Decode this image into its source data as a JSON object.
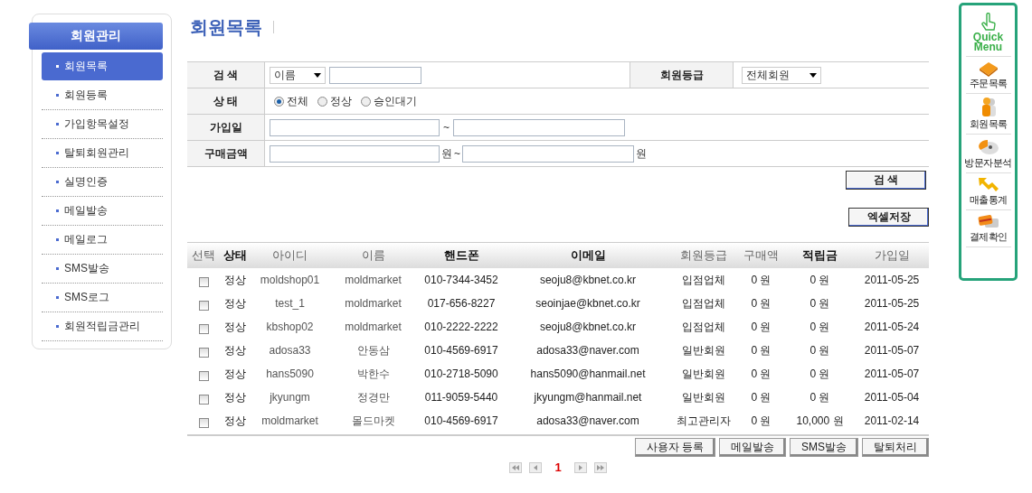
{
  "sidebar": {
    "title": "회원관리",
    "items": [
      {
        "label": "회원목록",
        "selected": true
      },
      {
        "label": "회원등록",
        "selected": false
      },
      {
        "label": "가입항목설정",
        "selected": false
      },
      {
        "label": "탈퇴회원관리",
        "selected": false
      },
      {
        "label": "실명인증",
        "selected": false
      },
      {
        "label": "메일발송",
        "selected": false
      },
      {
        "label": "메일로그",
        "selected": false
      },
      {
        "label": "SMS발송",
        "selected": false
      },
      {
        "label": "SMS로그",
        "selected": false
      },
      {
        "label": "회원적립금관리",
        "selected": false
      }
    ]
  },
  "page_title": "회원목록",
  "search_form": {
    "search_label": "검 색",
    "search_type": "이름",
    "grade_label": "회원등급",
    "grade_select": "전체회원",
    "status_label": "상 태",
    "status_options": [
      {
        "label": "전체",
        "selected": true
      },
      {
        "label": "정상",
        "selected": false
      },
      {
        "label": "승인대기",
        "selected": false
      }
    ],
    "join_label": "가입일",
    "join_separator": "~",
    "amount_label": "구매금액",
    "amount_unit": "원",
    "amount_separator": "~",
    "amount_unit_end": "원"
  },
  "search_button": "검 색",
  "excel_button": "엑셀저장",
  "table": {
    "columns": [
      {
        "label": "선택",
        "bold": false
      },
      {
        "label": "상태",
        "bold": true
      },
      {
        "label": "아이디",
        "bold": false
      },
      {
        "label": "이름",
        "bold": false
      },
      {
        "label": "핸드폰",
        "bold": true
      },
      {
        "label": "이메일",
        "bold": true
      },
      {
        "label": "회원등급",
        "bold": false
      },
      {
        "label": "구매액",
        "bold": false
      },
      {
        "label": "적립금",
        "bold": true
      },
      {
        "label": "가입일",
        "bold": false
      }
    ],
    "rows": [
      {
        "checked": false,
        "cells": [
          "",
          "정상",
          "moldshop01",
          "moldmarket",
          "010-7344-3452",
          "seoju8@kbnet.co.kr",
          "입점업체",
          "0 원",
          "0 원",
          "2011-05-25"
        ]
      },
      {
        "checked": false,
        "cells": [
          "",
          "정상",
          "test_1",
          "moldmarket",
          "017-656-8227",
          "seoinjae@kbnet.co.kr",
          "입점업체",
          "0 원",
          "0 원",
          "2011-05-25"
        ]
      },
      {
        "checked": false,
        "cells": [
          "",
          "정상",
          "kbshop02",
          "moldmarket",
          "010-2222-2222",
          "seoju8@kbnet.co.kr",
          "입점업체",
          "0 원",
          "0 원",
          "2011-05-24"
        ]
      },
      {
        "checked": false,
        "cells": [
          "",
          "정상",
          "adosa33",
          "안동삼",
          "010-4569-6917",
          "adosa33@naver.com",
          "일반회원",
          "0 원",
          "0 원",
          "2011-05-07"
        ]
      },
      {
        "checked": false,
        "cells": [
          "",
          "정상",
          "hans5090",
          "박한수",
          "010-2718-5090",
          "hans5090@hanmail.net",
          "일반회원",
          "0 원",
          "0 원",
          "2011-05-07"
        ]
      },
      {
        "checked": false,
        "cells": [
          "",
          "정상",
          "jkyungm",
          "정경만",
          "011-9059-5440",
          "jkyungm@hanmail.net",
          "일반회원",
          "0 원",
          "0 원",
          "2011-05-04"
        ]
      },
      {
        "checked": false,
        "cells": [
          "",
          "정상",
          "moldmarket",
          "몰드마켓",
          "010-4569-6917",
          "adosa33@naver.com",
          "최고관리자",
          "0 원",
          "10,000 원",
          "2011-02-14"
        ]
      }
    ]
  },
  "actions": [
    "사용자 등록",
    "메일발송",
    "SMS발송",
    "탈퇴처리"
  ],
  "pagination": {
    "pages": [
      {
        "label": "1",
        "selected": true
      }
    ]
  },
  "quick_menu": {
    "title": "Quick Menu",
    "items": [
      {
        "label": "주문목록",
        "kind": "folder"
      },
      {
        "label": "회원목록",
        "kind": "people"
      },
      {
        "label": "방문자분석",
        "kind": "pie"
      },
      {
        "label": "매출통계",
        "kind": "arrow"
      },
      {
        "label": "결제확인",
        "kind": "card"
      }
    ]
  }
}
